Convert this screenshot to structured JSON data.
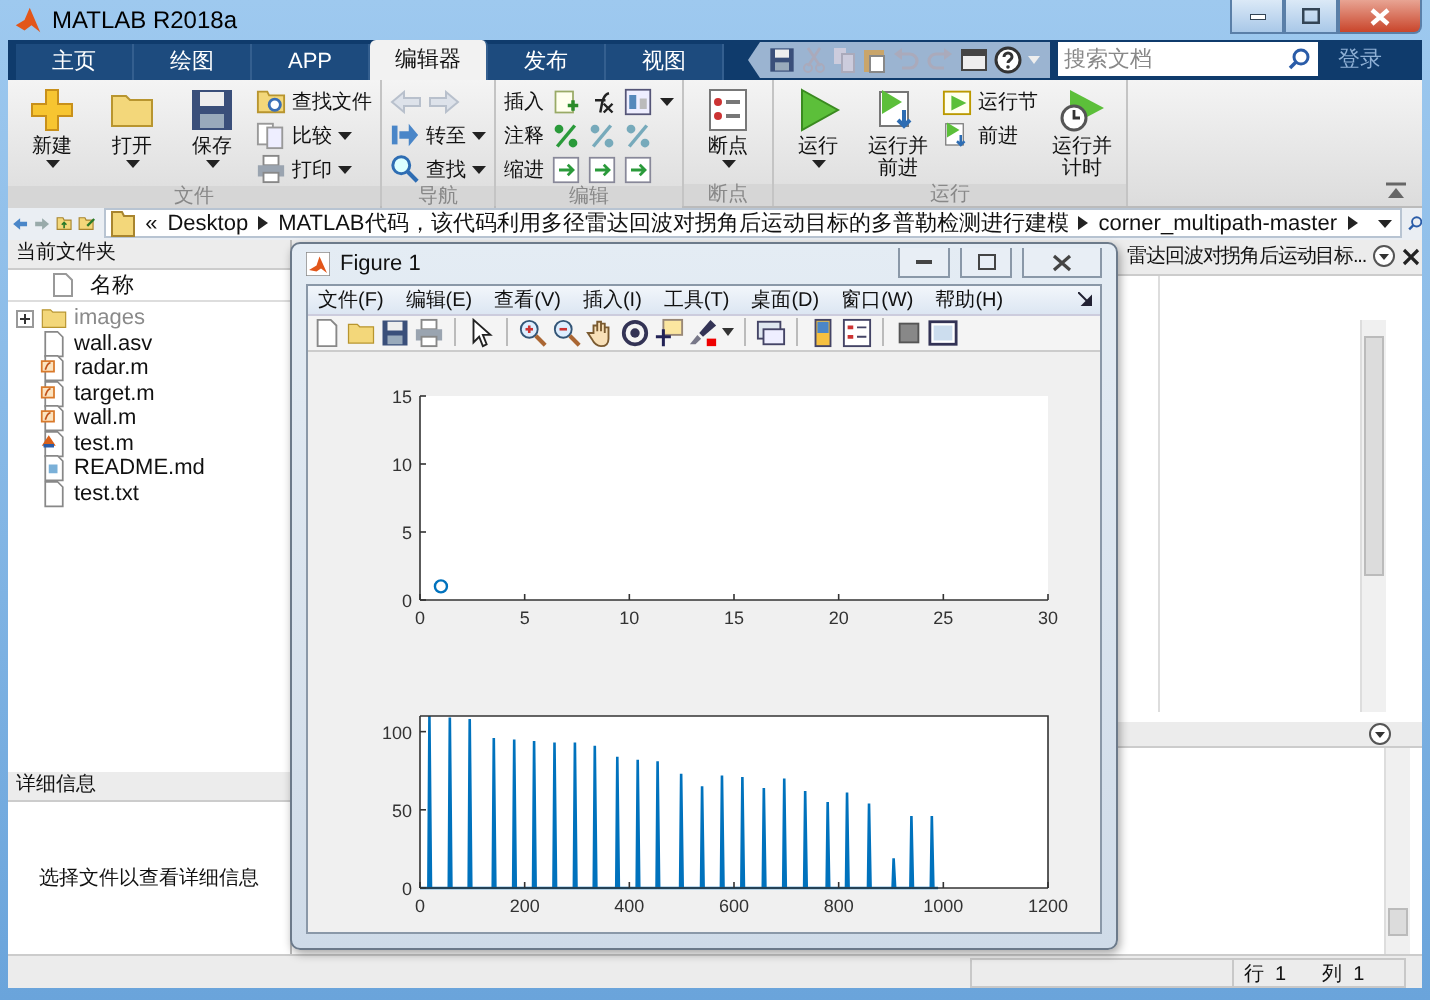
{
  "window": {
    "title": "MATLAB R2018a"
  },
  "tabs": [
    {
      "label": "主页",
      "selected": false
    },
    {
      "label": "绘图",
      "selected": false
    },
    {
      "label": "APP",
      "selected": false
    },
    {
      "label": "编辑器",
      "selected": true
    },
    {
      "label": "发布",
      "selected": false
    },
    {
      "label": "视图",
      "selected": false
    }
  ],
  "search": {
    "placeholder": "搜索文档"
  },
  "login": "登录",
  "ribbon": {
    "groups": [
      {
        "label": "文件",
        "columns": [
          {
            "kind": "large",
            "label": "新建",
            "dropdown": true
          },
          {
            "kind": "large",
            "label": "打开",
            "dropdown": true
          },
          {
            "kind": "large",
            "label": "保存",
            "dropdown": true
          },
          {
            "kind": "stack",
            "items": [
              {
                "kind": "button",
                "label": "查找文件",
                "dropdown": false
              },
              {
                "kind": "button",
                "label": "比较",
                "dropdown": true
              },
              {
                "kind": "button",
                "label": "打印",
                "dropdown": true
              }
            ]
          }
        ]
      },
      {
        "label": "导航",
        "columns": [
          {
            "kind": "stack",
            "items": [
              {
                "kind": "nav_arrows",
                "disabled": true
              },
              {
                "kind": "button",
                "label": "转至",
                "dropdown": true
              },
              {
                "kind": "button",
                "label": "查找",
                "dropdown": true
              }
            ]
          }
        ]
      },
      {
        "label": "编辑",
        "columns": [
          {
            "kind": "stack",
            "items": [
              {
                "kind": "icon_row",
                "label": "插入",
                "dropdown": true
              },
              {
                "kind": "icon_row",
                "label": "注释",
                "dropdown": false
              },
              {
                "kind": "icon_row",
                "label": "缩进",
                "dropdown": false
              }
            ]
          }
        ]
      },
      {
        "label": "断点",
        "columns": [
          {
            "kind": "large",
            "label": "断点",
            "dropdown": true
          }
        ]
      },
      {
        "label": "运行",
        "columns": [
          {
            "kind": "large",
            "label": "运行",
            "dropdown": true
          },
          {
            "kind": "large",
            "label": "运行并前进",
            "dropdown": false
          },
          {
            "kind": "stack",
            "items": [
              {
                "kind": "button",
                "label": "运行节",
                "dropdown": false
              },
              {
                "kind": "button",
                "label": "前进",
                "dropdown": false
              }
            ]
          },
          {
            "kind": "large",
            "label": "运行并计时",
            "dropdown": false
          }
        ]
      }
    ]
  },
  "address_bar": {
    "segments": [
      "«",
      "Desktop",
      "MATLAB代码，该代码利用多径雷达回波对拐角后运动目标的多普勒检测进行建模",
      "corner_multipath-master"
    ]
  },
  "current_folder": {
    "title": "当前文件夹",
    "column": "名称",
    "files": [
      {
        "name": "images",
        "kind": "folder",
        "expanded": false
      },
      {
        "name": "wall.asv",
        "kind": "file"
      },
      {
        "name": "radar.m",
        "kind": "function"
      },
      {
        "name": "target.m",
        "kind": "function"
      },
      {
        "name": "wall.m",
        "kind": "function"
      },
      {
        "name": "test.m",
        "kind": "script"
      },
      {
        "name": "README.md",
        "kind": "document"
      },
      {
        "name": "test.txt",
        "kind": "file"
      }
    ]
  },
  "details": {
    "title": "详细信息",
    "message": "选择文件以查看详细信息"
  },
  "editor": {
    "tab_title": "雷达回波对拐角后运动目标..."
  },
  "figure": {
    "title": "Figure 1",
    "menu": [
      "文件(F)",
      "编辑(E)",
      "查看(V)",
      "插入(I)",
      "工具(T)",
      "桌面(D)",
      "窗口(W)",
      "帮助(H)"
    ],
    "axes": [
      {
        "chart_data": {
          "type": "scatter",
          "x": [
            1
          ],
          "series": [
            {
              "color": "#0072bd",
              "values": [
                1
              ]
            }
          ],
          "xlim": [
            0,
            30
          ],
          "ylim": [
            0,
            15
          ],
          "xticks": [
            0,
            5,
            10,
            15,
            20,
            25,
            30
          ],
          "yticks": [
            0,
            5,
            10,
            15
          ]
        }
      },
      {
        "chart_data": {
          "type": "line",
          "x": [
            0,
            16,
            18,
            21,
            55,
            57,
            60,
            93,
            95,
            98,
            139,
            141,
            144,
            178,
            180,
            183,
            216,
            218,
            221,
            255,
            257,
            260,
            294,
            296,
            299,
            332,
            334,
            337,
            375,
            377,
            380,
            414,
            416,
            419,
            452,
            454,
            457,
            497,
            499,
            502,
            537,
            539,
            542,
            575,
            577,
            580,
            614,
            616,
            619,
            655,
            657,
            660,
            694,
            696,
            699,
            734,
            736,
            739,
            777,
            779,
            782,
            814,
            816,
            819,
            856,
            858,
            861,
            903,
            905,
            908,
            937,
            939,
            942,
            976,
            978,
            981,
            990
          ],
          "series": [
            {
              "color": "#0072bd",
              "values": [
                0,
                0,
                110,
                0,
                0,
                109,
                0,
                0,
                108,
                0,
                0,
                96,
                0,
                0,
                95,
                0,
                0,
                94,
                0,
                0,
                93,
                0,
                0,
                93,
                0,
                0,
                91,
                0,
                0,
                84,
                0,
                0,
                82,
                0,
                0,
                81,
                0,
                0,
                73,
                0,
                0,
                65,
                0,
                0,
                72,
                0,
                0,
                71,
                0,
                0,
                64,
                0,
                0,
                70,
                0,
                0,
                62,
                0,
                0,
                55,
                0,
                0,
                61,
                0,
                0,
                54,
                0,
                0,
                19,
                0,
                0,
                46,
                0,
                0,
                46,
                0,
                0
              ]
            }
          ],
          "xlim": [
            0,
            1200
          ],
          "ylim": [
            0,
            110
          ],
          "xticks": [
            0,
            200,
            400,
            600,
            800,
            1000,
            1200
          ],
          "yticks": [
            0,
            50,
            100
          ]
        }
      }
    ]
  },
  "status_bar": {
    "row_label": "行",
    "row": "1",
    "col_label": "列",
    "col": "1"
  }
}
